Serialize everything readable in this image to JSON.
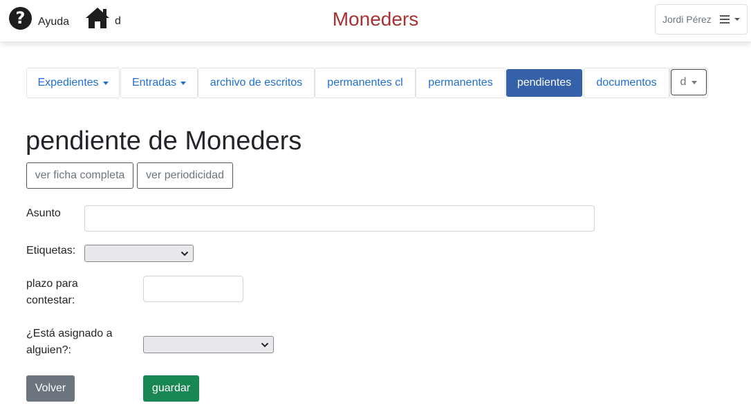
{
  "header": {
    "help_label": "Ayuda",
    "home_label": "d",
    "brand": "Moneders",
    "brand_color": "#a83232",
    "user_name": "Jordi Pérez"
  },
  "tabs": [
    {
      "label": "Expedientes",
      "dropdown": true
    },
    {
      "label": "Entradas",
      "dropdown": true
    },
    {
      "label": "archivo de escritos",
      "dropdown": false
    },
    {
      "label": "permanentes cl",
      "dropdown": false
    },
    {
      "label": "permanentes",
      "dropdown": false
    },
    {
      "label": "pendientes",
      "dropdown": false,
      "active": true
    },
    {
      "label": "documentos",
      "dropdown": false
    },
    {
      "label": "d",
      "dropdown": true
    }
  ],
  "page": {
    "title": "pendiente de Moneders",
    "view_full_label": "ver ficha completa",
    "view_periodicity_label": "ver periodicidad"
  },
  "form": {
    "subject_label": "Asunto",
    "subject_value": "",
    "tags_label": "Etiquetas:",
    "tags_selected": "",
    "deadline_label_1": "plazo para",
    "deadline_label_2": "contestar:",
    "deadline_value": "",
    "assigned_label_1": "¿Está asignado a",
    "assigned_label_2": "alguien?:",
    "assigned_selected": ""
  },
  "actions": {
    "back_label": "Volver",
    "save_label": "guardar",
    "save_color": "#198754",
    "back_color": "#6c757d"
  }
}
